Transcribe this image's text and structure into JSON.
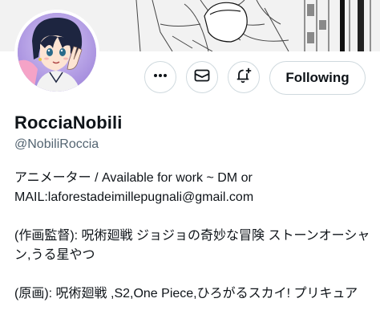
{
  "profile": {
    "display_name": "RocciaNobili",
    "handle": "@NobiliRoccia",
    "bio_lines": [
      "アニメーター / Available for work ~ DM or MAIL:laforestadeimillepugnali@gmail.com",
      "(作画監督): 呪術廻戦 ジョジョの奇妙な冒険 ストーンオーシャン,うる星やつ",
      "(原画): 呪術廻戦 ,S2,One Piece,ひろがるスカイ! プリキュア"
    ]
  },
  "actions": {
    "more_icon": "more-horizontal-icon",
    "message_icon": "envelope-icon",
    "notify_icon": "bell-plus-icon",
    "follow_label": "Following"
  },
  "colors": {
    "text_primary": "#0f1419",
    "text_secondary": "#536471",
    "border": "#cfd9de"
  }
}
